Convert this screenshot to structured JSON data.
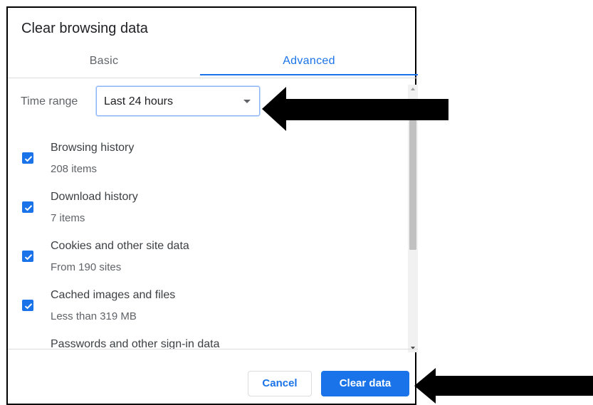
{
  "dialog": {
    "title": "Clear browsing data"
  },
  "tabs": [
    {
      "label": "Basic",
      "active": false
    },
    {
      "label": "Advanced",
      "active": true
    }
  ],
  "time_range": {
    "label": "Time range",
    "value": "Last 24 hours"
  },
  "items": [
    {
      "label": "Browsing history",
      "sub": "208 items",
      "checked": true
    },
    {
      "label": "Download history",
      "sub": "7 items",
      "checked": true
    },
    {
      "label": "Cookies and other site data",
      "sub": "From 190 sites",
      "checked": true
    },
    {
      "label": "Cached images and files",
      "sub": "Less than 319 MB",
      "checked": true
    },
    {
      "label": "Passwords and other sign-in data",
      "sub": "",
      "checked": false
    }
  ],
  "buttons": {
    "cancel": "Cancel",
    "clear": "Clear data"
  },
  "colors": {
    "accent": "#1a73e8",
    "annotation_arrow": "#000000"
  },
  "icons": {
    "checkbox": "checkmark-icon",
    "dropdown": "dropdown-arrow-icon",
    "annotation": "left-arrow-icon"
  }
}
